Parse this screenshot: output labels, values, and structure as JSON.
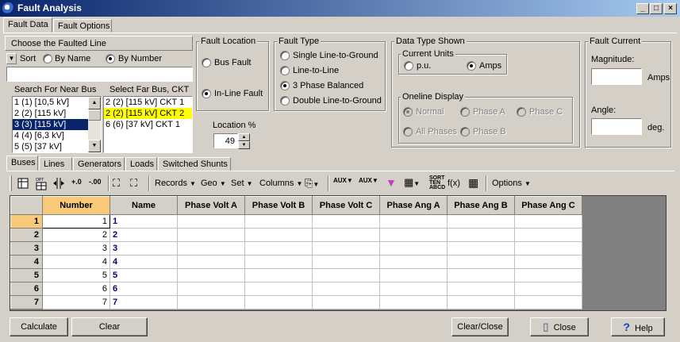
{
  "window": {
    "title": "Fault Analysis"
  },
  "tabs": [
    "Fault Data",
    "Fault Options"
  ],
  "choose_line": {
    "title": "Choose the Faulted Line",
    "sort_label": "Sort",
    "by_name": "By Name",
    "by_number": "By Number",
    "near_bus_title": "Search For Near Bus",
    "far_bus_title": "Select Far Bus, CKT",
    "near_bus_items": [
      "1 (1)  [10,5 kV]",
      "2 (2)  [115 kV]",
      "3 (3)  [115 kV]",
      "4 (4)  [6,3 kV]",
      "5 (5)  [37 kV]"
    ],
    "far_bus_items": [
      "2 (2) [115 kV] CKT  1",
      "2 (2) [115 kV] CKT  2",
      "6 (6) [37 kV] CKT  1"
    ]
  },
  "fault_location": {
    "title": "Fault Location",
    "bus_fault": "Bus Fault",
    "inline_fault": "In-Line Fault",
    "location_label": "Location %",
    "location_value": "49"
  },
  "fault_type": {
    "title": "Fault Type",
    "options": [
      "Single Line-to-Ground",
      "Line-to-Line",
      "3 Phase Balanced",
      "Double Line-to-Ground"
    ]
  },
  "data_type": {
    "title": "Data Type Shown",
    "current_units": "Current Units",
    "pu": "p.u.",
    "amps": "Amps",
    "oneline_display": "Oneline Display",
    "normal": "Normal",
    "phase_a": "Phase A",
    "phase_c": "Phase C",
    "all_phases": "All Phases",
    "phase_b": "Phase B"
  },
  "fault_current": {
    "title": "Fault Current",
    "magnitude": "Magnitude:",
    "amps_unit": "Amps",
    "angle": "Angle:",
    "deg_unit": "deg.",
    "magnitude_value": "",
    "angle_value": ""
  },
  "lower_tabs": [
    "Buses",
    "Lines",
    "Generators",
    "Loads",
    "Switched Shunts"
  ],
  "toolbar": {
    "records": "Records",
    "geo": "Geo",
    "set": "Set",
    "columns": "Columns",
    "fx": "f(x)",
    "options": "Options"
  },
  "table": {
    "headers": [
      "Number",
      "Name",
      "Phase Volt A",
      "Phase Volt B",
      "Phase Volt C",
      "Phase Ang A",
      "Phase Ang B",
      "Phase Ang C"
    ],
    "rows": [
      {
        "rownum": "1",
        "number": "1",
        "name": "1"
      },
      {
        "rownum": "2",
        "number": "2",
        "name": "2"
      },
      {
        "rownum": "3",
        "number": "3",
        "name": "3"
      },
      {
        "rownum": "4",
        "number": "4",
        "name": "4"
      },
      {
        "rownum": "5",
        "number": "5",
        "name": "5"
      },
      {
        "rownum": "6",
        "number": "6",
        "name": "6"
      },
      {
        "rownum": "7",
        "number": "7",
        "name": "7"
      }
    ]
  },
  "buttons": {
    "calculate": "Calculate",
    "clear": "Clear",
    "clear_close": "Clear/Close",
    "close": "Close",
    "help": "Help"
  }
}
